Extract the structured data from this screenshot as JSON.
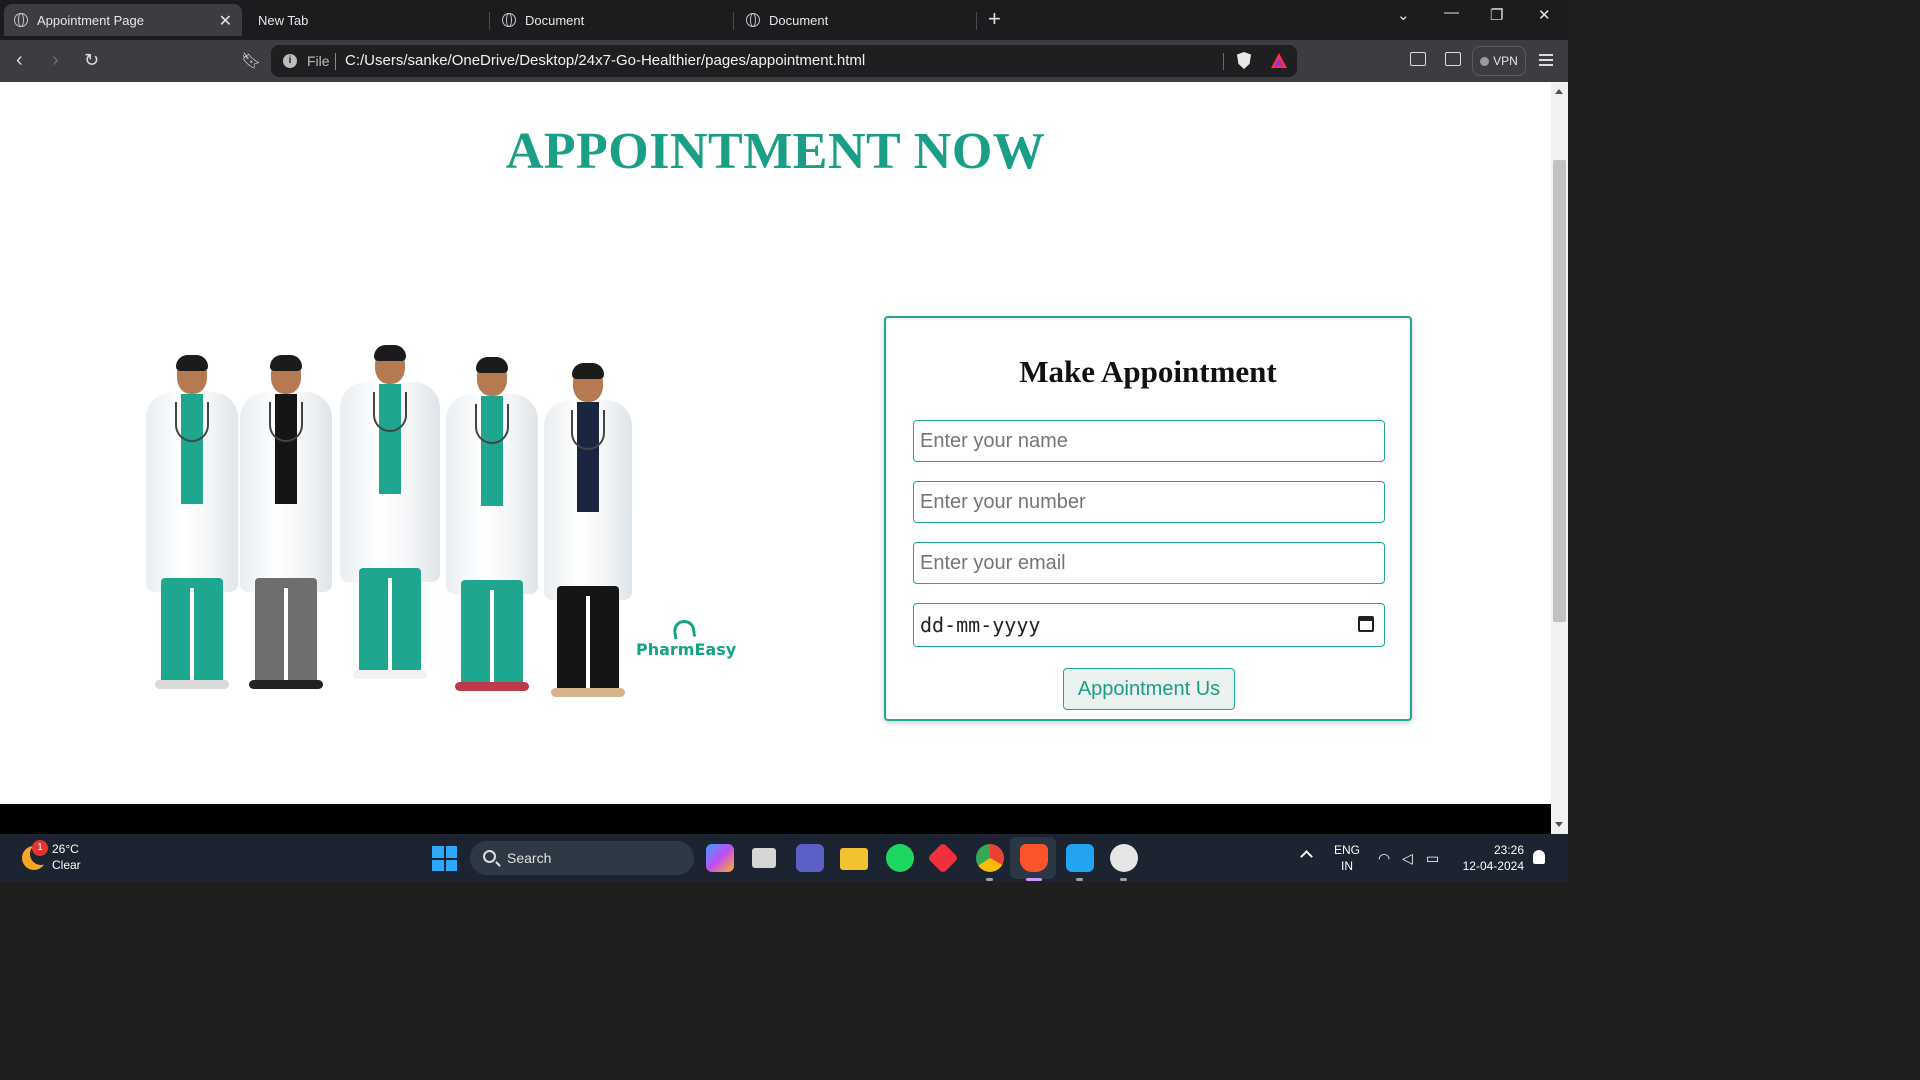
{
  "browser": {
    "tabs": [
      {
        "label": "Appointment Page",
        "active": true
      },
      {
        "label": "New Tab",
        "active": false
      },
      {
        "label": "Document",
        "active": false
      },
      {
        "label": "Document",
        "active": false
      }
    ],
    "omnibox": {
      "scheme_label": "File",
      "url": "C:/Users/sanke/OneDrive/Desktop/24x7-Go-Healthier/pages/appointment.html"
    },
    "vpn_label": "VPN",
    "icons": [
      "back-icon",
      "forward-icon",
      "reload-icon",
      "bookmark-icon",
      "info-icon",
      "brave-shield-icon",
      "brave-rewards-icon",
      "sidebar-icon",
      "wallet-icon",
      "menu-icon"
    ]
  },
  "page": {
    "heading": "APPOINTMENT NOW",
    "heading_color": "#1a9e86",
    "image": {
      "brand_text": "PharmEasy"
    },
    "form": {
      "title": "Make Appointment",
      "name_placeholder": "Enter your name",
      "number_placeholder": "Enter your number",
      "email_placeholder": "Enter your email",
      "date_placeholder": "dd-mm-yyyy",
      "submit_label": "Appointment Us",
      "accent_color": "#1fa88f"
    }
  },
  "taskbar": {
    "weather": {
      "badge": "1",
      "temperature": "26°C",
      "condition": "Clear"
    },
    "search_label": "Search",
    "language": {
      "line1": "ENG",
      "line2": "IN"
    },
    "clock": {
      "time": "23:26",
      "date": "12-04-2024"
    },
    "apps": [
      "copilot-icon",
      "task-view-icon",
      "teams-icon",
      "file-explorer-icon",
      "spotify-icon",
      "git-icon",
      "chrome-icon",
      "brave-icon",
      "vscode-icon",
      "github-desktop-icon"
    ]
  }
}
